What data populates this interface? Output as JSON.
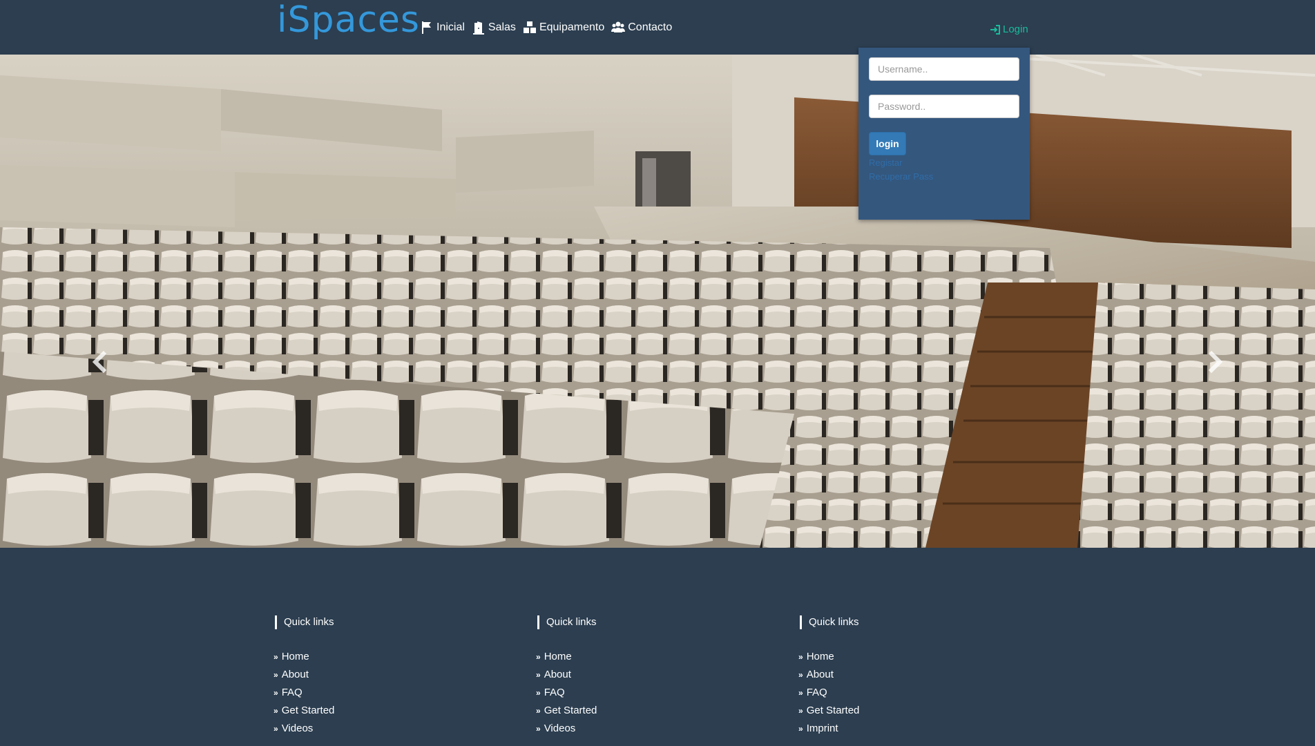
{
  "brand": {
    "name": "iSpaces"
  },
  "nav": {
    "items": [
      {
        "label": "Inicial",
        "icon": "flag-icon"
      },
      {
        "label": "Salas",
        "icon": "door-icon"
      },
      {
        "label": "Equipamento",
        "icon": "boxes-icon"
      },
      {
        "label": "Contacto",
        "icon": "users-icon"
      }
    ],
    "login_label": "Login"
  },
  "login_panel": {
    "username_placeholder": "Username..",
    "password_placeholder": "Password..",
    "button_label": "login",
    "register_label": "Registar",
    "recover_label": "Recuperar Pass"
  },
  "footer": {
    "columns": [
      {
        "heading": "Quick links",
        "links": [
          "Home",
          "About",
          "FAQ",
          "Get Started",
          "Videos"
        ]
      },
      {
        "heading": "Quick links",
        "links": [
          "Home",
          "About",
          "FAQ",
          "Get Started",
          "Videos"
        ]
      },
      {
        "heading": "Quick links",
        "links": [
          "Home",
          "About",
          "FAQ",
          "Get Started",
          "Imprint"
        ]
      }
    ]
  },
  "colors": {
    "background": "#2c3e50",
    "brand": "#3498db",
    "login_link": "#1abc9c",
    "panel": "#34577e",
    "button": "#337ab7"
  }
}
